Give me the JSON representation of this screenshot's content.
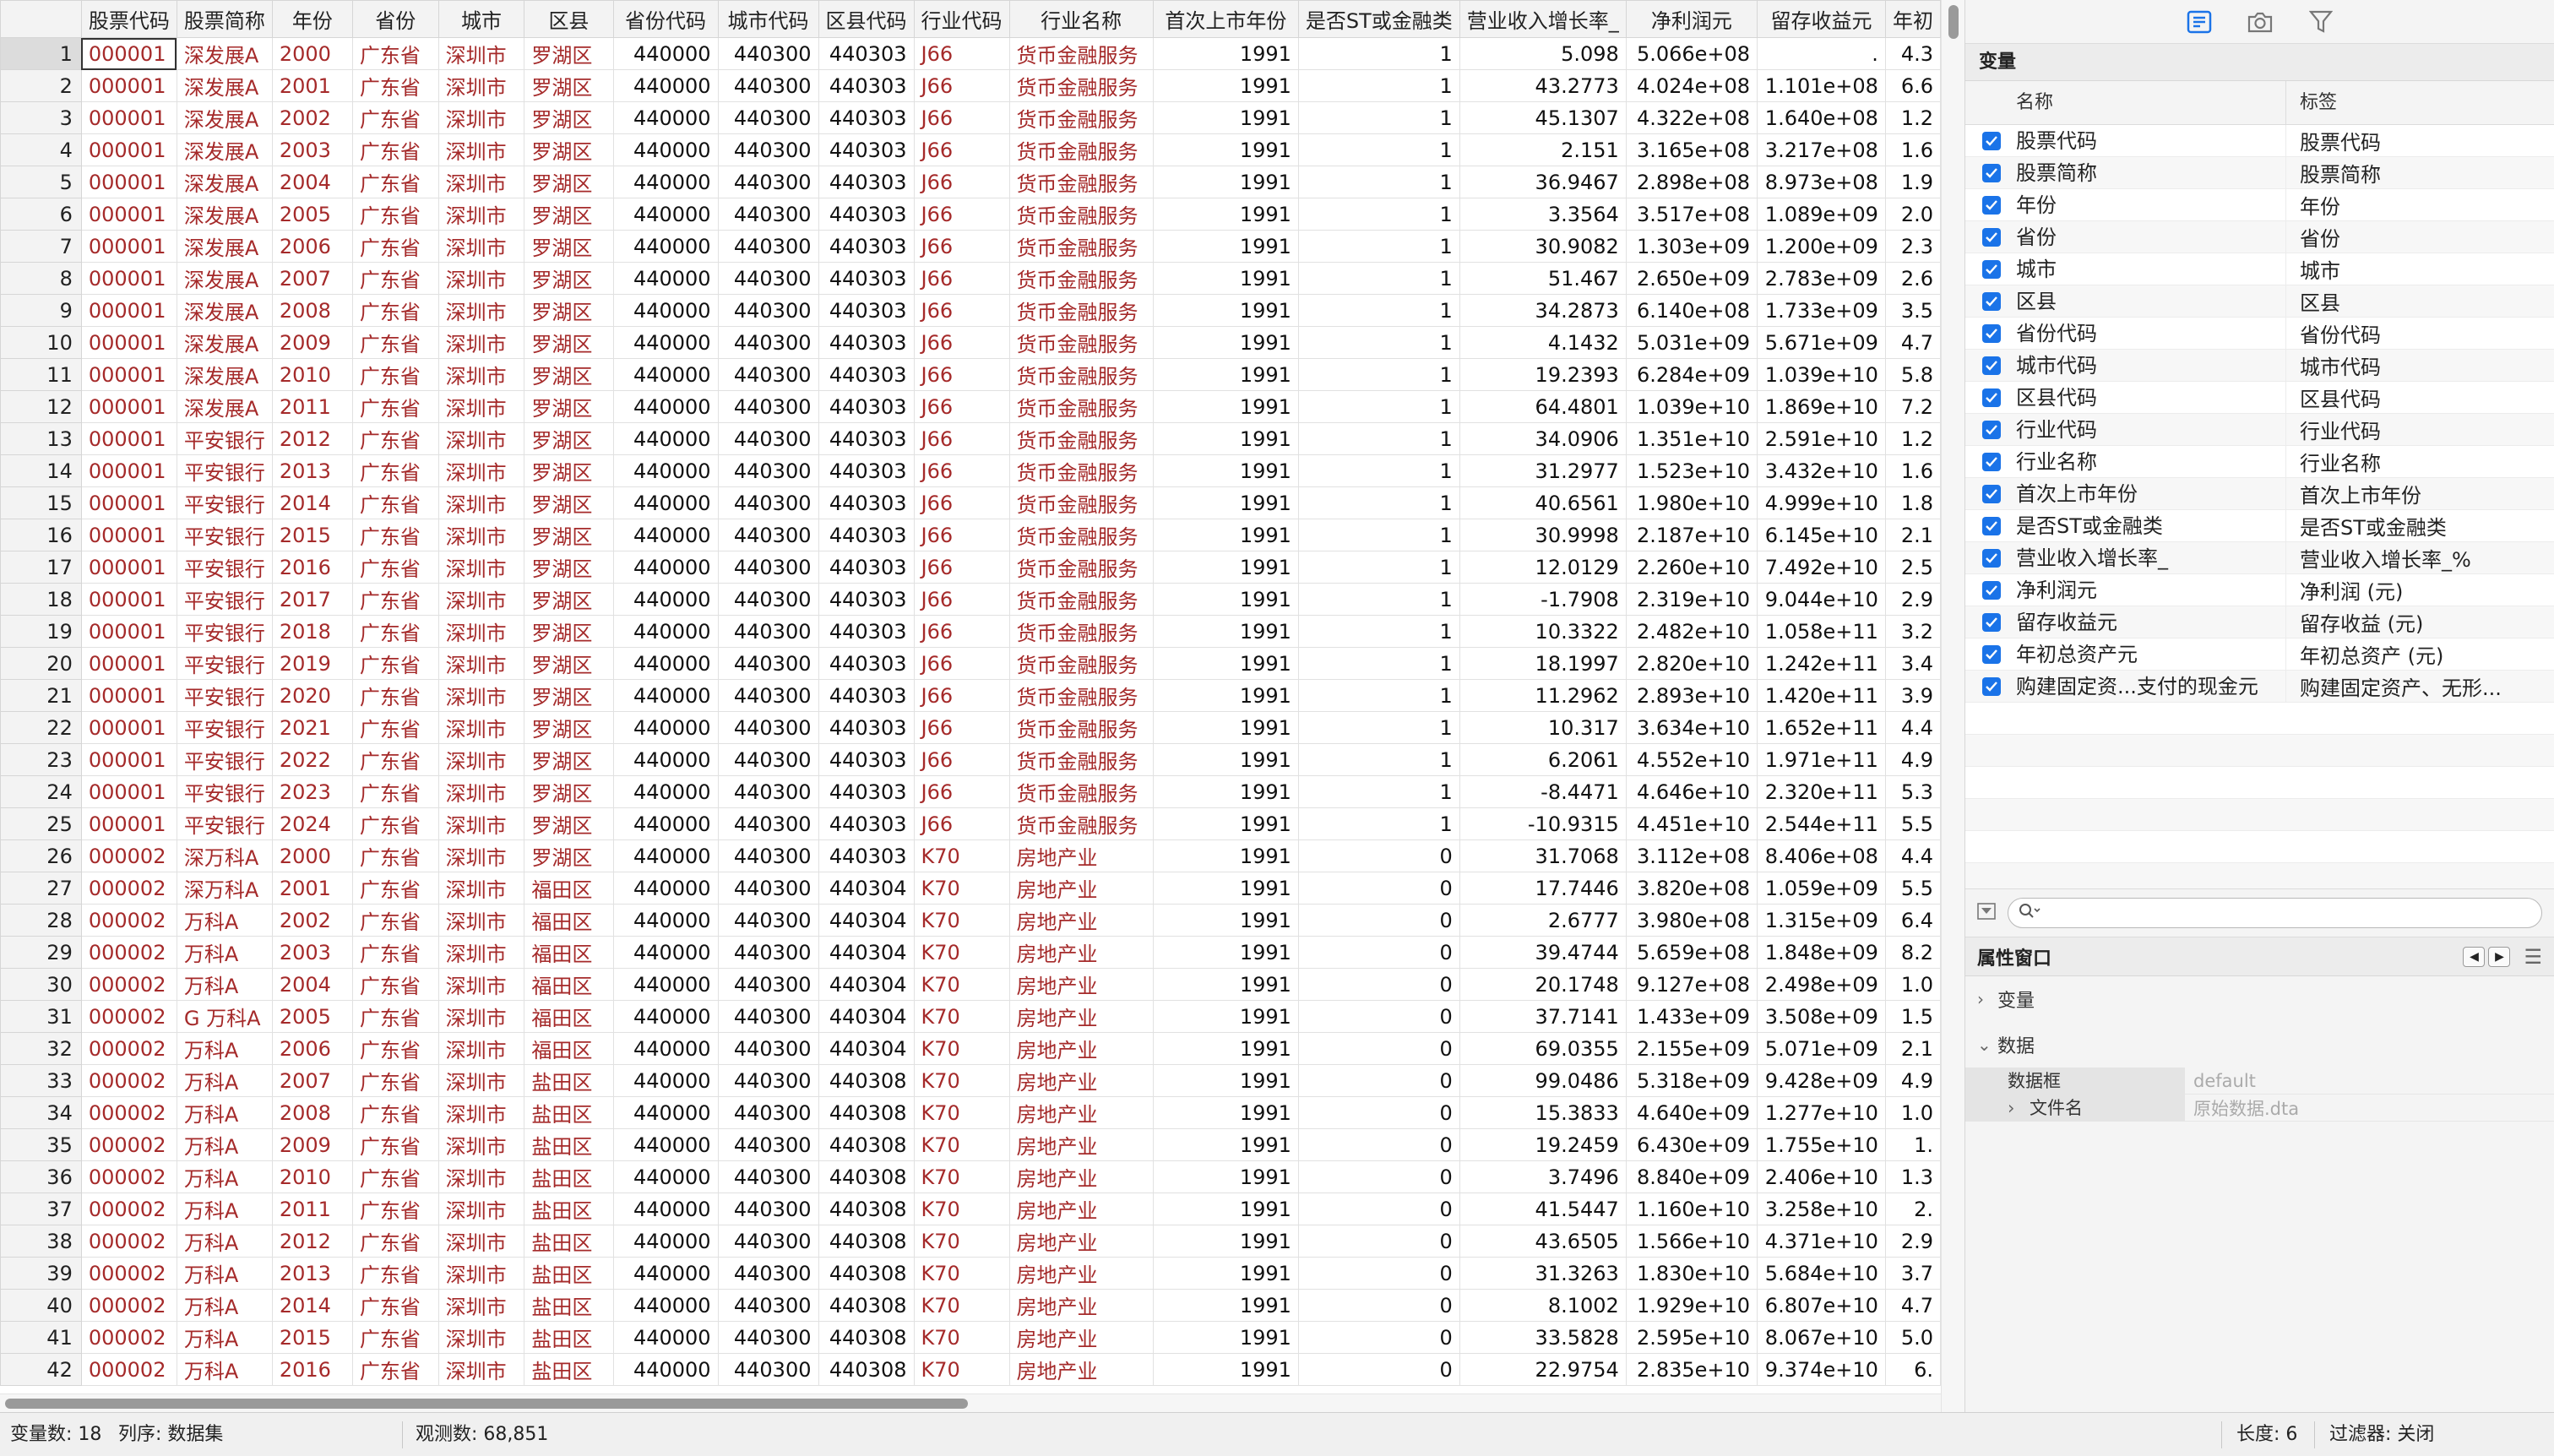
{
  "columns": [
    "股票代码",
    "股票简称",
    "年份",
    "省份",
    "城市",
    "区县",
    "省份代码",
    "城市代码",
    "区县代码",
    "行业代码",
    "行业名称",
    "首次上市年份",
    "是否ST或金融类",
    "营业收入增长率_",
    "净利润元",
    "留存收益元",
    "年初"
  ],
  "column_types": [
    "str",
    "str",
    "str",
    "str",
    "str",
    "str",
    "num",
    "num",
    "num",
    "str",
    "str",
    "num",
    "num",
    "num",
    "num",
    "num",
    "num"
  ],
  "rows": [
    [
      "1",
      "000001",
      "深发展A",
      "2000",
      "广东省",
      "深圳市",
      "罗湖区",
      "440000",
      "440300",
      "440303",
      "J66",
      "货币金融服务",
      "1991",
      "1",
      "5.098",
      "5.066e+08",
      ".",
      "4.3"
    ],
    [
      "2",
      "000001",
      "深发展A",
      "2001",
      "广东省",
      "深圳市",
      "罗湖区",
      "440000",
      "440300",
      "440303",
      "J66",
      "货币金融服务",
      "1991",
      "1",
      "43.2773",
      "4.024e+08",
      "1.101e+08",
      "6.6"
    ],
    [
      "3",
      "000001",
      "深发展A",
      "2002",
      "广东省",
      "深圳市",
      "罗湖区",
      "440000",
      "440300",
      "440303",
      "J66",
      "货币金融服务",
      "1991",
      "1",
      "45.1307",
      "4.322e+08",
      "1.640e+08",
      "1.2"
    ],
    [
      "4",
      "000001",
      "深发展A",
      "2003",
      "广东省",
      "深圳市",
      "罗湖区",
      "440000",
      "440300",
      "440303",
      "J66",
      "货币金融服务",
      "1991",
      "1",
      "2.151",
      "3.165e+08",
      "3.217e+08",
      "1.6"
    ],
    [
      "5",
      "000001",
      "深发展A",
      "2004",
      "广东省",
      "深圳市",
      "罗湖区",
      "440000",
      "440300",
      "440303",
      "J66",
      "货币金融服务",
      "1991",
      "1",
      "36.9467",
      "2.898e+08",
      "8.973e+08",
      "1.9"
    ],
    [
      "6",
      "000001",
      "深发展A",
      "2005",
      "广东省",
      "深圳市",
      "罗湖区",
      "440000",
      "440300",
      "440303",
      "J66",
      "货币金融服务",
      "1991",
      "1",
      "3.3564",
      "3.517e+08",
      "1.089e+09",
      "2.0"
    ],
    [
      "7",
      "000001",
      "深发展A",
      "2006",
      "广东省",
      "深圳市",
      "罗湖区",
      "440000",
      "440300",
      "440303",
      "J66",
      "货币金融服务",
      "1991",
      "1",
      "30.9082",
      "1.303e+09",
      "1.200e+09",
      "2.3"
    ],
    [
      "8",
      "000001",
      "深发展A",
      "2007",
      "广东省",
      "深圳市",
      "罗湖区",
      "440000",
      "440300",
      "440303",
      "J66",
      "货币金融服务",
      "1991",
      "1",
      "51.467",
      "2.650e+09",
      "2.783e+09",
      "2.6"
    ],
    [
      "9",
      "000001",
      "深发展A",
      "2008",
      "广东省",
      "深圳市",
      "罗湖区",
      "440000",
      "440300",
      "440303",
      "J66",
      "货币金融服务",
      "1991",
      "1",
      "34.2873",
      "6.140e+08",
      "1.733e+09",
      "3.5"
    ],
    [
      "10",
      "000001",
      "深发展A",
      "2009",
      "广东省",
      "深圳市",
      "罗湖区",
      "440000",
      "440300",
      "440303",
      "J66",
      "货币金融服务",
      "1991",
      "1",
      "4.1432",
      "5.031e+09",
      "5.671e+09",
      "4.7"
    ],
    [
      "11",
      "000001",
      "深发展A",
      "2010",
      "广东省",
      "深圳市",
      "罗湖区",
      "440000",
      "440300",
      "440303",
      "J66",
      "货币金融服务",
      "1991",
      "1",
      "19.2393",
      "6.284e+09",
      "1.039e+10",
      "5.8"
    ],
    [
      "12",
      "000001",
      "深发展A",
      "2011",
      "广东省",
      "深圳市",
      "罗湖区",
      "440000",
      "440300",
      "440303",
      "J66",
      "货币金融服务",
      "1991",
      "1",
      "64.4801",
      "1.039e+10",
      "1.869e+10",
      "7.2"
    ],
    [
      "13",
      "000001",
      "平安银行",
      "2012",
      "广东省",
      "深圳市",
      "罗湖区",
      "440000",
      "440300",
      "440303",
      "J66",
      "货币金融服务",
      "1991",
      "1",
      "34.0906",
      "1.351e+10",
      "2.591e+10",
      "1.2"
    ],
    [
      "14",
      "000001",
      "平安银行",
      "2013",
      "广东省",
      "深圳市",
      "罗湖区",
      "440000",
      "440300",
      "440303",
      "J66",
      "货币金融服务",
      "1991",
      "1",
      "31.2977",
      "1.523e+10",
      "3.432e+10",
      "1.6"
    ],
    [
      "15",
      "000001",
      "平安银行",
      "2014",
      "广东省",
      "深圳市",
      "罗湖区",
      "440000",
      "440300",
      "440303",
      "J66",
      "货币金融服务",
      "1991",
      "1",
      "40.6561",
      "1.980e+10",
      "4.999e+10",
      "1.8"
    ],
    [
      "16",
      "000001",
      "平安银行",
      "2015",
      "广东省",
      "深圳市",
      "罗湖区",
      "440000",
      "440300",
      "440303",
      "J66",
      "货币金融服务",
      "1991",
      "1",
      "30.9998",
      "2.187e+10",
      "6.145e+10",
      "2.1"
    ],
    [
      "17",
      "000001",
      "平安银行",
      "2016",
      "广东省",
      "深圳市",
      "罗湖区",
      "440000",
      "440300",
      "440303",
      "J66",
      "货币金融服务",
      "1991",
      "1",
      "12.0129",
      "2.260e+10",
      "7.492e+10",
      "2.5"
    ],
    [
      "18",
      "000001",
      "平安银行",
      "2017",
      "广东省",
      "深圳市",
      "罗湖区",
      "440000",
      "440300",
      "440303",
      "J66",
      "货币金融服务",
      "1991",
      "1",
      "-1.7908",
      "2.319e+10",
      "9.044e+10",
      "2.9"
    ],
    [
      "19",
      "000001",
      "平安银行",
      "2018",
      "广东省",
      "深圳市",
      "罗湖区",
      "440000",
      "440300",
      "440303",
      "J66",
      "货币金融服务",
      "1991",
      "1",
      "10.3322",
      "2.482e+10",
      "1.058e+11",
      "3.2"
    ],
    [
      "20",
      "000001",
      "平安银行",
      "2019",
      "广东省",
      "深圳市",
      "罗湖区",
      "440000",
      "440300",
      "440303",
      "J66",
      "货币金融服务",
      "1991",
      "1",
      "18.1997",
      "2.820e+10",
      "1.242e+11",
      "3.4"
    ],
    [
      "21",
      "000001",
      "平安银行",
      "2020",
      "广东省",
      "深圳市",
      "罗湖区",
      "440000",
      "440300",
      "440303",
      "J66",
      "货币金融服务",
      "1991",
      "1",
      "11.2962",
      "2.893e+10",
      "1.420e+11",
      "3.9"
    ],
    [
      "22",
      "000001",
      "平安银行",
      "2021",
      "广东省",
      "深圳市",
      "罗湖区",
      "440000",
      "440300",
      "440303",
      "J66",
      "货币金融服务",
      "1991",
      "1",
      "10.317",
      "3.634e+10",
      "1.652e+11",
      "4.4"
    ],
    [
      "23",
      "000001",
      "平安银行",
      "2022",
      "广东省",
      "深圳市",
      "罗湖区",
      "440000",
      "440300",
      "440303",
      "J66",
      "货币金融服务",
      "1991",
      "1",
      "6.2061",
      "4.552e+10",
      "1.971e+11",
      "4.9"
    ],
    [
      "24",
      "000001",
      "平安银行",
      "2023",
      "广东省",
      "深圳市",
      "罗湖区",
      "440000",
      "440300",
      "440303",
      "J66",
      "货币金融服务",
      "1991",
      "1",
      "-8.4471",
      "4.646e+10",
      "2.320e+11",
      "5.3"
    ],
    [
      "25",
      "000001",
      "平安银行",
      "2024",
      "广东省",
      "深圳市",
      "罗湖区",
      "440000",
      "440300",
      "440303",
      "J66",
      "货币金融服务",
      "1991",
      "1",
      "-10.9315",
      "4.451e+10",
      "2.544e+11",
      "5.5"
    ],
    [
      "26",
      "000002",
      "深万科A",
      "2000",
      "广东省",
      "深圳市",
      "罗湖区",
      "440000",
      "440300",
      "440303",
      "K70",
      "房地产业",
      "1991",
      "0",
      "31.7068",
      "3.112e+08",
      "8.406e+08",
      "4.4"
    ],
    [
      "27",
      "000002",
      "深万科A",
      "2001",
      "广东省",
      "深圳市",
      "福田区",
      "440000",
      "440300",
      "440304",
      "K70",
      "房地产业",
      "1991",
      "0",
      "17.7446",
      "3.820e+08",
      "1.059e+09",
      "5.5"
    ],
    [
      "28",
      "000002",
      "万科A",
      "2002",
      "广东省",
      "深圳市",
      "福田区",
      "440000",
      "440300",
      "440304",
      "K70",
      "房地产业",
      "1991",
      "0",
      "2.6777",
      "3.980e+08",
      "1.315e+09",
      "6.4"
    ],
    [
      "29",
      "000002",
      "万科A",
      "2003",
      "广东省",
      "深圳市",
      "福田区",
      "440000",
      "440300",
      "440304",
      "K70",
      "房地产业",
      "1991",
      "0",
      "39.4744",
      "5.659e+08",
      "1.848e+09",
      "8.2"
    ],
    [
      "30",
      "000002",
      "万科A",
      "2004",
      "广东省",
      "深圳市",
      "福田区",
      "440000",
      "440300",
      "440304",
      "K70",
      "房地产业",
      "1991",
      "0",
      "20.1748",
      "9.127e+08",
      "2.498e+09",
      "1.0"
    ],
    [
      "31",
      "000002",
      "G 万科A",
      "2005",
      "广东省",
      "深圳市",
      "福田区",
      "440000",
      "440300",
      "440304",
      "K70",
      "房地产业",
      "1991",
      "0",
      "37.7141",
      "1.433e+09",
      "3.508e+09",
      "1.5"
    ],
    [
      "32",
      "000002",
      "万科A",
      "2006",
      "广东省",
      "深圳市",
      "福田区",
      "440000",
      "440300",
      "440304",
      "K70",
      "房地产业",
      "1991",
      "0",
      "69.0355",
      "2.155e+09",
      "5.071e+09",
      "2.1"
    ],
    [
      "33",
      "000002",
      "万科A",
      "2007",
      "广东省",
      "深圳市",
      "盐田区",
      "440000",
      "440300",
      "440308",
      "K70",
      "房地产业",
      "1991",
      "0",
      "99.0486",
      "5.318e+09",
      "9.428e+09",
      "4.9"
    ],
    [
      "34",
      "000002",
      "万科A",
      "2008",
      "广东省",
      "深圳市",
      "盐田区",
      "440000",
      "440300",
      "440308",
      "K70",
      "房地产业",
      "1991",
      "0",
      "15.3833",
      "4.640e+09",
      "1.277e+10",
      "1.0"
    ],
    [
      "35",
      "000002",
      "万科A",
      "2009",
      "广东省",
      "深圳市",
      "盐田区",
      "440000",
      "440300",
      "440308",
      "K70",
      "房地产业",
      "1991",
      "0",
      "19.2459",
      "6.430e+09",
      "1.755e+10",
      "1."
    ],
    [
      "36",
      "000002",
      "万科A",
      "2010",
      "广东省",
      "深圳市",
      "盐田区",
      "440000",
      "440300",
      "440308",
      "K70",
      "房地产业",
      "1991",
      "0",
      "3.7496",
      "8.840e+09",
      "2.406e+10",
      "1.3"
    ],
    [
      "37",
      "000002",
      "万科A",
      "2011",
      "广东省",
      "深圳市",
      "盐田区",
      "440000",
      "440300",
      "440308",
      "K70",
      "房地产业",
      "1991",
      "0",
      "41.5447",
      "1.160e+10",
      "3.258e+10",
      "2."
    ],
    [
      "38",
      "000002",
      "万科A",
      "2012",
      "广东省",
      "深圳市",
      "盐田区",
      "440000",
      "440300",
      "440308",
      "K70",
      "房地产业",
      "1991",
      "0",
      "43.6505",
      "1.566e+10",
      "4.371e+10",
      "2.9"
    ],
    [
      "39",
      "000002",
      "万科A",
      "2013",
      "广东省",
      "深圳市",
      "盐田区",
      "440000",
      "440300",
      "440308",
      "K70",
      "房地产业",
      "1991",
      "0",
      "31.3263",
      "1.830e+10",
      "5.684e+10",
      "3.7"
    ],
    [
      "40",
      "000002",
      "万科A",
      "2014",
      "广东省",
      "深圳市",
      "盐田区",
      "440000",
      "440300",
      "440308",
      "K70",
      "房地产业",
      "1991",
      "0",
      "8.1002",
      "1.929e+10",
      "6.807e+10",
      "4.7"
    ],
    [
      "41",
      "000002",
      "万科A",
      "2015",
      "广东省",
      "深圳市",
      "盐田区",
      "440000",
      "440300",
      "440308",
      "K70",
      "房地产业",
      "1991",
      "0",
      "33.5828",
      "2.595e+10",
      "8.067e+10",
      "5.0"
    ],
    [
      "42",
      "000002",
      "万科A",
      "2016",
      "广东省",
      "深圳市",
      "盐田区",
      "440000",
      "440300",
      "440308",
      "K70",
      "房地产业",
      "1991",
      "0",
      "22.9754",
      "2.835e+10",
      "9.374e+10",
      "6."
    ]
  ],
  "variables_panel": {
    "title": "变量",
    "header_name": "名称",
    "header_label": "标签",
    "items": [
      {
        "name": "股票代码",
        "label": "股票代码"
      },
      {
        "name": "股票简称",
        "label": "股票简称"
      },
      {
        "name": "年份",
        "label": "年份"
      },
      {
        "name": "省份",
        "label": "省份"
      },
      {
        "name": "城市",
        "label": "城市"
      },
      {
        "name": "区县",
        "label": "区县"
      },
      {
        "name": "省份代码",
        "label": "省份代码"
      },
      {
        "name": "城市代码",
        "label": "城市代码"
      },
      {
        "name": "区县代码",
        "label": "区县代码"
      },
      {
        "name": "行业代码",
        "label": "行业代码"
      },
      {
        "name": "行业名称",
        "label": "行业名称"
      },
      {
        "name": "首次上市年份",
        "label": "首次上市年份"
      },
      {
        "name": "是否ST或金融类",
        "label": "是否ST或金融类"
      },
      {
        "name": "营业收入增长率_",
        "label": "营业收入增长率_%"
      },
      {
        "name": "净利润元",
        "label": "净利润 (元)"
      },
      {
        "name": "留存收益元",
        "label": "留存收益 (元)"
      },
      {
        "name": "年初总资产元",
        "label": "年初总资产 (元)"
      },
      {
        "name": "购建固定资...支付的现金元",
        "label": "购建固定资产、无形..."
      }
    ],
    "filter_placeholder": ""
  },
  "properties_panel": {
    "title": "属性窗口",
    "sections": [
      "变量",
      "数据"
    ],
    "rows": [
      {
        "key": "数据框",
        "value": "default"
      },
      {
        "key": "文件名",
        "value": "原始数据.dta"
      }
    ]
  },
  "status_bar": {
    "vars": "变量数: 18",
    "order": "列序: 数据集",
    "obs": "观测数: 68,851",
    "length": "长度: 6",
    "filter": "过滤器: 关闭"
  },
  "colors": {
    "string_text": "#a52a2a",
    "checkbox": "#1a73e8",
    "toolbar_active_icon": "#1a73e8"
  },
  "icons": [
    "variables-icon",
    "snapshot-camera-icon",
    "filter-funnel-icon",
    "search-icon",
    "filter-options-icon",
    "prev-arrow-icon",
    "next-arrow-icon",
    "menu-lines-icon"
  ]
}
